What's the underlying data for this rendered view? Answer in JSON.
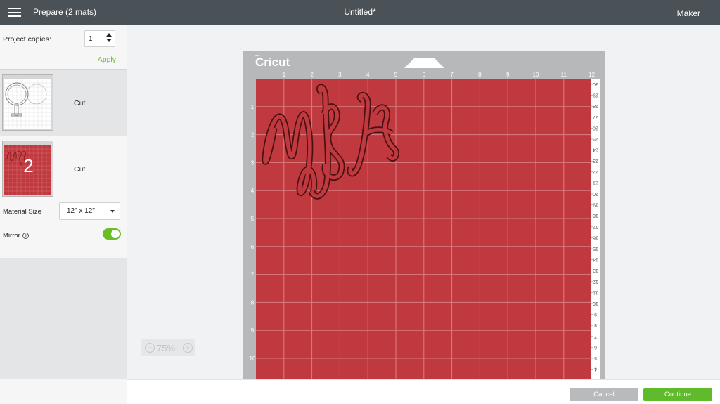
{
  "header": {
    "menu_icon": "hamburger-menu-icon",
    "title": "Prepare (2 mats)",
    "project_name": "Untitled*",
    "machine": "Maker"
  },
  "sidebar": {
    "copies_label": "Project copies:",
    "copies_value": "1",
    "apply_label": "Apply",
    "mats": [
      {
        "action": "Cut",
        "color": "#ffffff",
        "mat_number": ""
      },
      {
        "action": "Cut",
        "color": "#c0393e",
        "mat_number": "2"
      }
    ],
    "material_size_label": "Material Size",
    "material_size_value": "12\" x 12\"",
    "mirror_label": "Mirror",
    "mirror_on": true
  },
  "zoom": {
    "minus": "−",
    "value": "75%",
    "plus": "+"
  },
  "mat": {
    "brand": "Cricut",
    "color": "#c0393e",
    "top_ruler": [
      "1",
      "2",
      "3",
      "4",
      "5",
      "6",
      "7",
      "8",
      "9",
      "10",
      "11",
      "12"
    ],
    "left_ruler": [
      "1",
      "2",
      "3",
      "4",
      "5",
      "6",
      "7",
      "8",
      "9",
      "10"
    ],
    "right_ruler": [
      "30",
      "29",
      "28",
      "27",
      "26",
      "25",
      "24",
      "23",
      "22",
      "21",
      "20",
      "19",
      "18",
      "17",
      "16",
      "15",
      "14",
      "13",
      "12",
      "11",
      "10",
      "9",
      "8",
      "7",
      "6",
      "5",
      "4"
    ]
  },
  "footer": {
    "cancel_label": "Cancel",
    "continue_label": "Continue"
  }
}
